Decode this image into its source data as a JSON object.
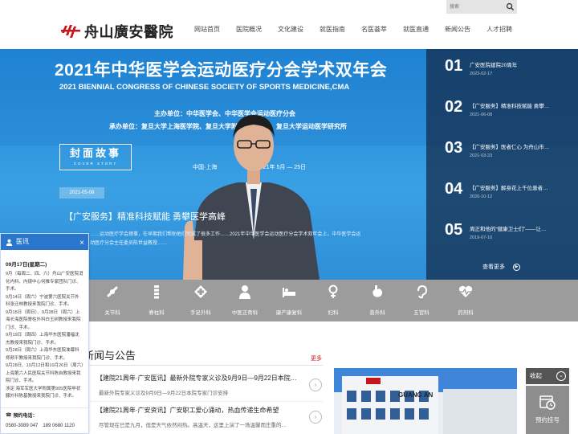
{
  "search": {
    "placeholder": "搜索",
    "icon": "search-icon"
  },
  "logo": {
    "text": "舟山廣安醫院",
    "brand_color": "#c8161d"
  },
  "nav": [
    "网站首页",
    "医院概况",
    "文化建设",
    "就医指南",
    "名医荟萃",
    "就医直通",
    "新闻公告",
    "人才招聘"
  ],
  "banner": {
    "title_cn": "2021年中华医学会运动医疗分会学术双年会",
    "title_en": "2021 BIENNIAL CONGRESS OF CHINESE SOCIETY OF SPORTS MEDICINE,CMA",
    "host": "主办单位：中华医学会、中华医学会运动医疗分会",
    "organizer": "承办单位：复旦大学上海医学院、复旦大学附属华山医院、复旦大学运动医学研究所",
    "place": "中国·上海",
    "dates": "2021年 5月 — 25日",
    "cover_cn": "封面故事",
    "cover_en": "COVER STORY",
    "date": "2021-05-08",
    "headline": "【广安服务】精准科技赋能 勇攀医学高峰",
    "summary": "……运动医疗学会理事，在早期我们帮助他们完成了很多工作……2021年中华医学会运动医疗分会学术双年会上，中华医学会运动医疗分会主任委员陈世益教授……"
  },
  "banner_list": {
    "items": [
      {
        "num": "01",
        "title": "广安医院建院20周年",
        "date": "2023-02-17"
      },
      {
        "num": "02",
        "title": "【广安服务】精准科技赋能 勇攀…",
        "date": "2021-06-08"
      },
      {
        "num": "03",
        "title": "【广安服务】医者仁心 为舟山市…",
        "date": "2021-03-23"
      },
      {
        "num": "04",
        "title": "【广安服务】解身花上千位患者…",
        "date": "2020-10-12"
      },
      {
        "num": "05",
        "title": "周正和他的“健康卫士们”——让…",
        "date": "2019-07-10"
      }
    ],
    "more": "查看更多"
  },
  "departments": [
    "关节科",
    "脊柱科",
    "手足外科",
    "中医正骨科",
    "康产康复科",
    "妇科",
    "普外科",
    "五官科",
    "药剂科"
  ],
  "news": {
    "heading": "新闻与公告",
    "more": "更多",
    "items": [
      {
        "title": "【建院21周年·广安医讯】最新外院专家义诊及9月9日—9月22日本院…",
        "desc": "最新外院专家义诊及9月9日—9月22日本院专家门诊安排"
      },
      {
        "title": "【建院21周年·广安资讯】广安职工爱心涌动，热血传递生命希望",
        "desc": "尽管现在已是九月，但是天气依然闷热。高温天，这里上演了一场温馨而庄重的…"
      }
    ]
  },
  "side_widget": {
    "collapse": "收起",
    "booking": "预约挂号"
  },
  "popup": {
    "title": "医讯",
    "date": "09月17日(星期二)",
    "lines": [
      "9月（每周二、四、六）舟山广安医院消化内科、内镜中心何推专家团队门诊、手术。",
      "9月14日（周六）宁波第六医院关节外科张迁林教授来我院门诊、手术。",
      "9月15日（周日）、9月28日（周六）上海长海医院脊柱外科白玉树教授来我院门诊、手术。",
      "9月19日（周四）上海华东医院潘福沈杰教授来我院门诊、手术。",
      "9月28日（周六）上海华东医院准幕科郑频平教授来我院门诊、手术。",
      "9月28日、10月12日和10月26日（周六）上海第六人民医院关节科陈自教授来我院门诊、手术。",
      "涉定 海军军医大学附属第905医院甲状腺外科陈基教授来我院门诊、手术。"
    ],
    "phone_title": "预约电话：",
    "phone": "0580-3089 047　189 0680 1120"
  }
}
